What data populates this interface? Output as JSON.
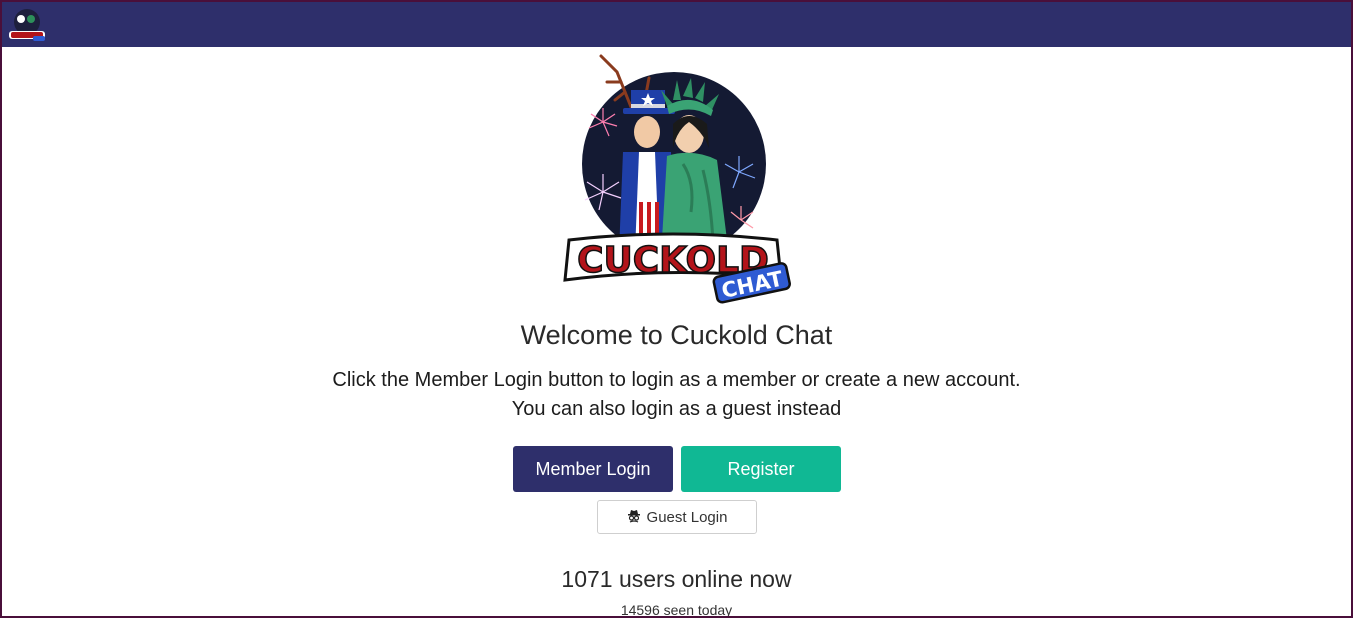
{
  "header": {
    "logo_icon": "cuckold-chat-logo-small",
    "background_color": "#2e2f6b"
  },
  "hero": {
    "logo_icon": "cuckold-chat-logo",
    "logo_text_main": "CUCKOLD",
    "logo_text_sub": "CHAT"
  },
  "welcome": {
    "title": "Welcome to Cuckold Chat",
    "line1": "Click the Member Login button to login as a member or create a new account.",
    "line2": "You can also login as a guest instead"
  },
  "actions": {
    "member_login": "Member Login",
    "register": "Register",
    "guest_login": "Guest Login",
    "guest_icon": "spy-icon",
    "member_color": "#2e2f6b",
    "register_color": "#10b894"
  },
  "stats": {
    "online": "1071 users online now",
    "seen": "14596 seen today"
  }
}
